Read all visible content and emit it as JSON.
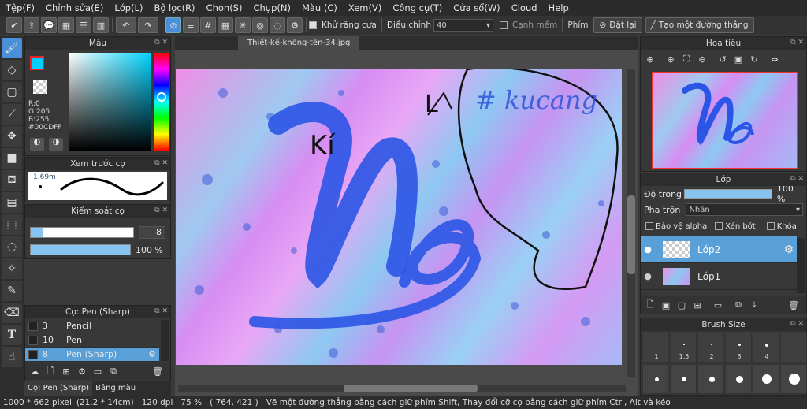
{
  "menu": [
    "Tệp(F)",
    "Chỉnh sửa(E)",
    "Lớp(L)",
    "Bộ lọc(R)",
    "Chọn(S)",
    "Chụp(N)",
    "Màu (C)",
    "Xem(V)",
    "Công cụ(T)",
    "Cửa sổ(W)",
    "Cloud",
    "Help"
  ],
  "toolbar": {
    "antialias_label": "Khử răng cưa",
    "adjust_label": "Điều chỉnh",
    "adjust_value": "40",
    "soft_edge_label": "Cạnh mềm",
    "key_label": "Phím",
    "reset_label": "Đặt lại",
    "straight_line_label": "Tạo một đường thẳng"
  },
  "color_panel": {
    "title": "Màu",
    "r": "R:0",
    "g": "G:205",
    "b": "B:255",
    "hex": "#00CDFF",
    "current_color": "#00cdff"
  },
  "brush_preview": {
    "title": "Xem trước cọ",
    "size": "1.69m"
  },
  "brush_control": {
    "title": "Kiểm soát cọ",
    "size_value": "8",
    "opacity_value": "100 %",
    "size_fraction": 0.12,
    "opacity_fraction": 1.0
  },
  "brush_list": {
    "title": "Cọ: Pen (Sharp)",
    "items": [
      {
        "size": "3",
        "name": "Pencil"
      },
      {
        "size": "10",
        "name": "Pen"
      },
      {
        "size": "8",
        "name": "Pen (Sharp)"
      }
    ],
    "tab1": "Cọ: Pen (Sharp)",
    "tab2": "Bảng màu"
  },
  "document": {
    "tab_title": "Thiết-kế-không-tên-34.jpg"
  },
  "canvas_text": {
    "ki": "Kí",
    "l": "L",
    "hash": "# kucang"
  },
  "navigator": {
    "title": "Hoa tiêu"
  },
  "layers": {
    "title": "Lớp",
    "opacity_label": "Độ trong",
    "opacity_value": "100 %",
    "blend_label": "Pha trộn",
    "blend_value": "Nhân",
    "protect_alpha": "Bảo vệ alpha",
    "clipping": "Xén bớt",
    "lock": "Khóa",
    "items": [
      {
        "name": "Lớp2"
      },
      {
        "name": "Lớp1"
      }
    ]
  },
  "brush_size": {
    "title": "Brush Size",
    "labels": [
      "1",
      "1.5",
      "2",
      "3",
      "4"
    ]
  },
  "status": {
    "pixels": "1000 * 662 pixel",
    "cm": "(21.2 * 14cm)",
    "dpi": "120 dpi",
    "zoom": "75 %",
    "coords": "( 764, 421 )",
    "hint": "Vẽ một đường thẳng bằng cách giữ phím Shift, Thay đổi cỡ cọ bằng cách giữ phím Ctrl, Alt và kéo"
  }
}
